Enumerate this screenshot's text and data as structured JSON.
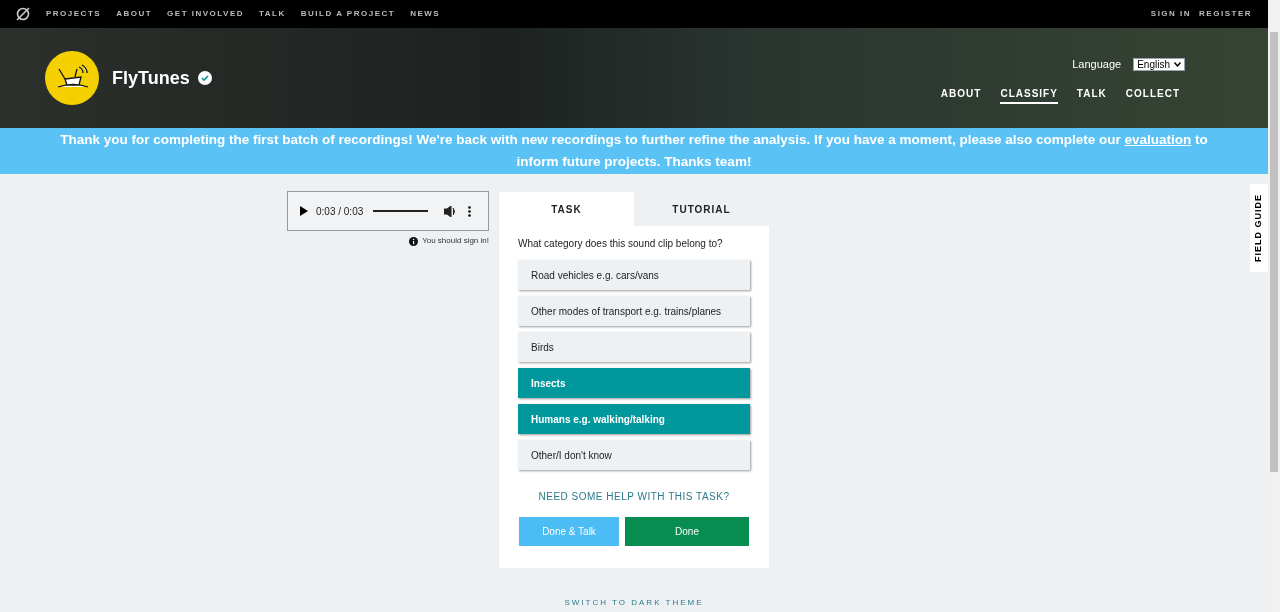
{
  "top_nav": {
    "links": [
      "PROJECTS",
      "ABOUT",
      "GET INVOLVED",
      "TALK",
      "BUILD A PROJECT",
      "NEWS"
    ],
    "account": [
      "SIGN IN",
      "REGISTER"
    ]
  },
  "project": {
    "name": "FlyTunes",
    "verified": true,
    "language_label": "Language",
    "language": "English",
    "nav": [
      {
        "label": "ABOUT",
        "selected": false
      },
      {
        "label": "CLASSIFY",
        "selected": true
      },
      {
        "label": "TALK",
        "selected": false
      },
      {
        "label": "COLLECT",
        "selected": false
      }
    ]
  },
  "announcement": {
    "before": "Thank you for completing the first batch of recordings! We're back with new recordings to further refine the analysis. If you have a moment, please also complete our",
    "link": "evaluation",
    "after": "to inform future projects. Thanks team!"
  },
  "player": {
    "time": "0:03 / 0:03",
    "level": 1.0,
    "sign_in_note": "You should sign in!"
  },
  "task_panel": {
    "tabs": [
      {
        "label": "TASK",
        "selected": true
      },
      {
        "label": "TUTORIAL",
        "selected": false
      }
    ],
    "question": "What category does this sound clip belong to?",
    "answers": [
      {
        "label": "Road vehicles e.g. cars/vans",
        "selected": false
      },
      {
        "label": "Other modes of transport e.g. trains/planes",
        "selected": false
      },
      {
        "label": "Birds",
        "selected": false
      },
      {
        "label": "Insects",
        "selected": true
      },
      {
        "label": "Humans e.g. walking/talking",
        "selected": true
      },
      {
        "label": "Other/I don't know",
        "selected": false
      }
    ],
    "help_link": "NEED SOME HELP WITH THIS TASK?",
    "buttons": [
      "Done & Talk",
      "Done"
    ]
  },
  "field_guide": "FIELD GUIDE",
  "theme_toggle": "SWITCH TO DARK THEME"
}
